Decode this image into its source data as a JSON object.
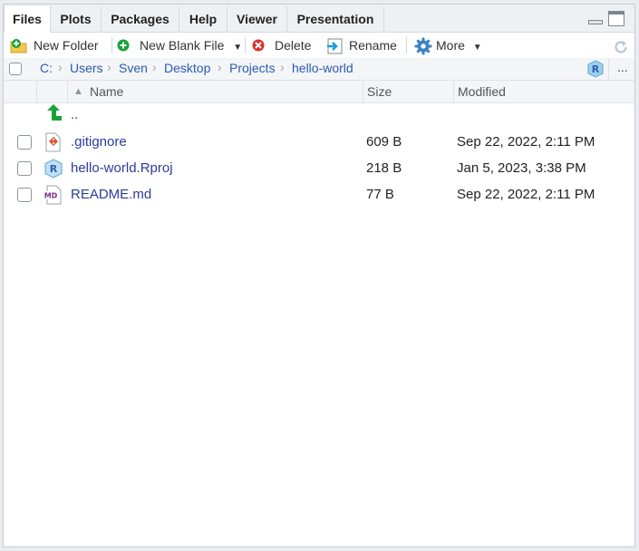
{
  "tabs": [
    {
      "label": "Files",
      "active": true
    },
    {
      "label": "Plots",
      "active": false
    },
    {
      "label": "Packages",
      "active": false
    },
    {
      "label": "Help",
      "active": false
    },
    {
      "label": "Viewer",
      "active": false
    },
    {
      "label": "Presentation",
      "active": false
    }
  ],
  "toolbar": {
    "new_folder": "New Folder",
    "new_blank_file": "New Blank File",
    "delete": "Delete",
    "rename": "Rename",
    "more": "More"
  },
  "breadcrumb": [
    "C:",
    "Users",
    "Sven",
    "Desktop",
    "Projects",
    "hello-world"
  ],
  "breadcrumb_more": "...",
  "columns": {
    "name": "Name",
    "size": "Size",
    "modified": "Modified"
  },
  "parent_dir": "..",
  "files": [
    {
      "name": ".gitignore",
      "size": "609 B",
      "modified": "Sep 22, 2022, 2:11 PM",
      "icon": "git-file-icon"
    },
    {
      "name": "hello-world.Rproj",
      "size": "218 B",
      "modified": "Jan 5, 2023, 3:38 PM",
      "icon": "rproj-file-icon"
    },
    {
      "name": "README.md",
      "size": "77 B",
      "modified": "Sep 22, 2022, 2:11 PM",
      "icon": "markdown-file-icon"
    }
  ],
  "md_badge": "MD",
  "r_glyph": "R",
  "colors": {
    "link": "#2c5bb3",
    "accent_green": "#1aa23a",
    "delete_red": "#d9312b",
    "rename_blue": "#1f9ad6",
    "gear_blue": "#3b82c4"
  }
}
